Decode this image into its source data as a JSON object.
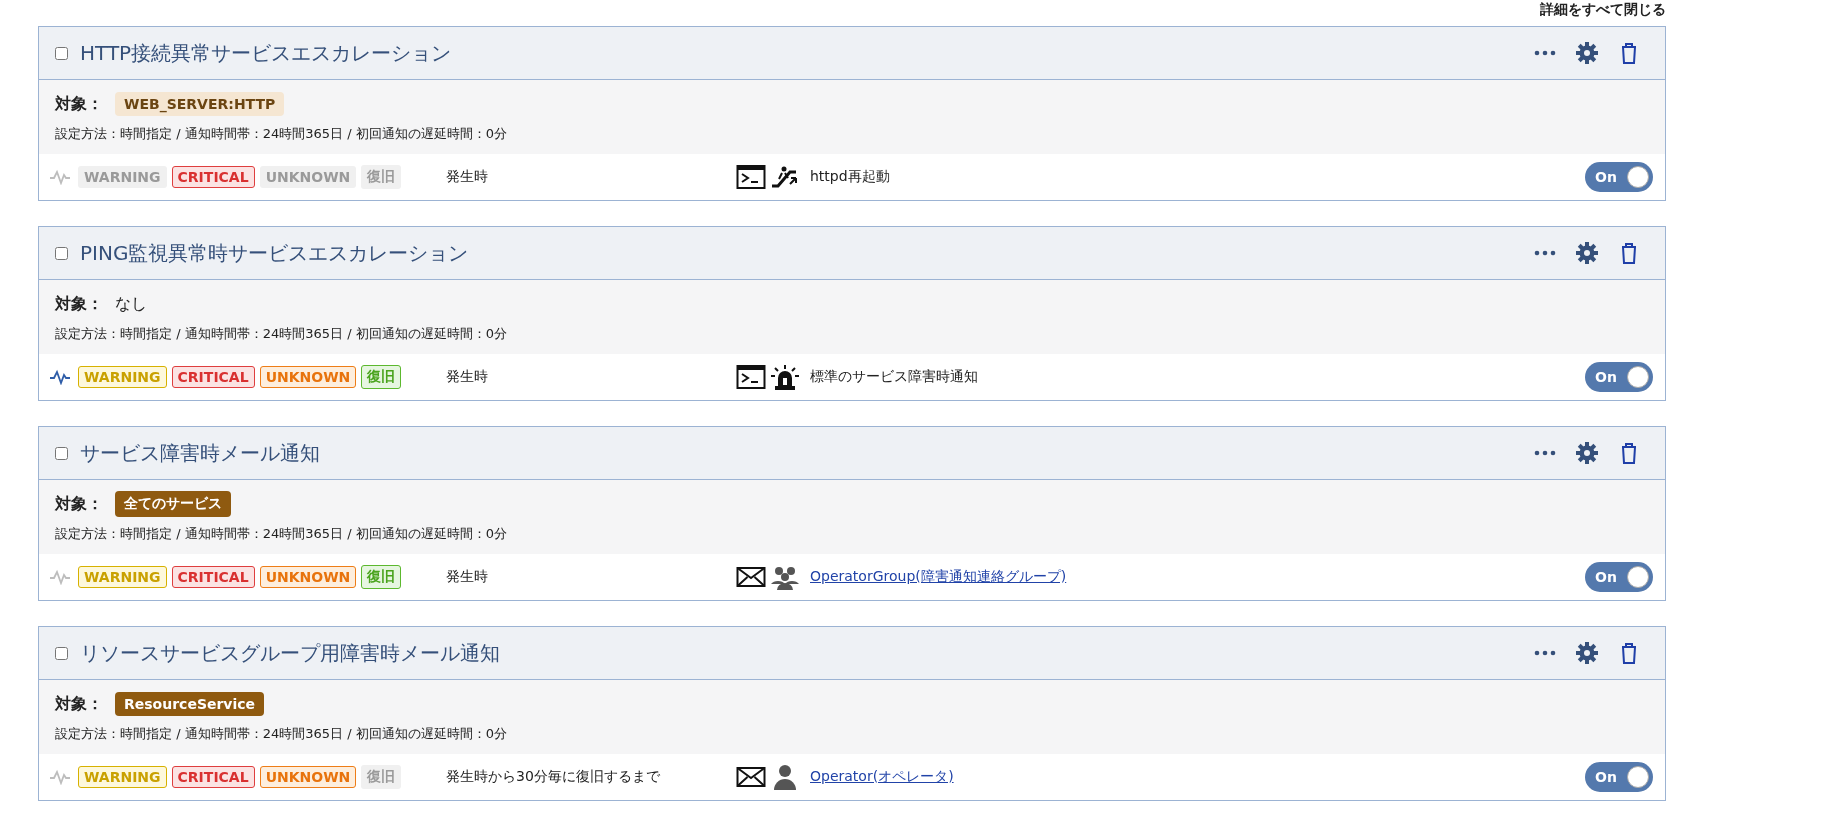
{
  "collapse_all_link": "詳細をすべて閉じる",
  "rules": [
    {
      "checked": false,
      "title": "HTTP接続異常サービスエスカレーション",
      "target_label": "対象：",
      "target": {
        "kind": "light",
        "text": "WEB_SERVER:HTTP"
      },
      "settings": "設定方法：時間指定 / 通知時間帯：24時間365日 / 初回通知の遅延時間：0分",
      "flapping": false,
      "statuses": [
        {
          "kind": "warning",
          "label": "WARNING",
          "on": false
        },
        {
          "kind": "critical",
          "label": "CRITICAL",
          "on": true
        },
        {
          "kind": "unknown",
          "label": "UNKNOWN",
          "on": false
        },
        {
          "kind": "recovery",
          "label": "復旧",
          "on": false
        }
      ],
      "timing": "発生時",
      "action": {
        "kind": "command",
        "recipient": {
          "kind": "escalator"
        },
        "text": "httpd再起動",
        "link": false
      },
      "enabled": true,
      "toggle_label": "On"
    },
    {
      "checked": false,
      "title": "PING監視異常時サービスエスカレーション",
      "target_label": "対象：",
      "target": {
        "kind": "plain",
        "text": "なし"
      },
      "settings": "設定方法：時間指定 / 通知時間帯：24時間365日 / 初回通知の遅延時間：0分",
      "flapping": true,
      "statuses": [
        {
          "kind": "warning",
          "label": "WARNING",
          "on": true
        },
        {
          "kind": "critical",
          "label": "CRITICAL",
          "on": true
        },
        {
          "kind": "unknown",
          "label": "UNKNOWN",
          "on": true
        },
        {
          "kind": "recovery",
          "label": "復旧",
          "on": true
        }
      ],
      "timing": "発生時",
      "action": {
        "kind": "command",
        "recipient": {
          "kind": "alarm"
        },
        "text": "標準のサービス障害時通知",
        "link": false
      },
      "enabled": true,
      "toggle_label": "On"
    },
    {
      "checked": false,
      "title": "サービス障害時メール通知",
      "target_label": "対象：",
      "target": {
        "kind": "dark",
        "text": "全てのサービス"
      },
      "settings": "設定方法：時間指定 / 通知時間帯：24時間365日 / 初回通知の遅延時間：0分",
      "flapping": false,
      "statuses": [
        {
          "kind": "warning",
          "label": "WARNING",
          "on": true
        },
        {
          "kind": "critical",
          "label": "CRITICAL",
          "on": true
        },
        {
          "kind": "unknown",
          "label": "UNKNOWN",
          "on": true
        },
        {
          "kind": "recovery",
          "label": "復旧",
          "on": true
        }
      ],
      "timing": "発生時",
      "action": {
        "kind": "mail",
        "recipient": {
          "kind": "group"
        },
        "text": "OperatorGroup(障害通知連絡グループ)",
        "link": true
      },
      "enabled": true,
      "toggle_label": "On"
    },
    {
      "checked": false,
      "title": "リソースサービスグループ用障害時メール通知",
      "target_label": "対象：",
      "target": {
        "kind": "dark",
        "text": "ResourceService"
      },
      "settings": "設定方法：時間指定 / 通知時間帯：24時間365日 / 初回通知の遅延時間：0分",
      "flapping": false,
      "statuses": [
        {
          "kind": "warning",
          "label": "WARNING",
          "on": true
        },
        {
          "kind": "critical",
          "label": "CRITICAL",
          "on": true
        },
        {
          "kind": "unknown",
          "label": "UNKNOWN",
          "on": true
        },
        {
          "kind": "recovery",
          "label": "復旧",
          "on": false
        }
      ],
      "timing": "発生時から30分毎に復旧するまで",
      "action": {
        "kind": "mail",
        "recipient": {
          "kind": "person"
        },
        "text": "Operator(オペレータ)",
        "link": true
      },
      "enabled": true,
      "toggle_label": "On"
    }
  ]
}
